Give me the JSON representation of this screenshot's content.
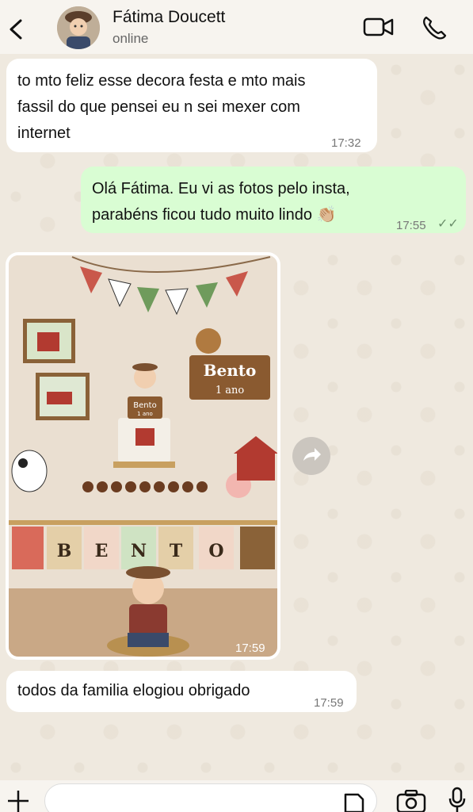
{
  "header": {
    "contact_name": "Fátima Doucett",
    "status": "online"
  },
  "messages": [
    {
      "dir": "in",
      "text_lines": [
        "to mto feliz esse decora festa e mto mais",
        "fassil do que pensei eu n sei mexer com",
        "internet"
      ],
      "time": "17:32"
    },
    {
      "dir": "out",
      "text_lines": [
        "Olá Fátima. Eu vi as fotos pelo insta,",
        "parabéns ficou tudo muito lindo 👏🏼"
      ],
      "time": "17:55",
      "ticks": "✓✓"
    },
    {
      "dir": "in",
      "type": "image",
      "time": "17:59",
      "photo": {
        "sign_name": "Bento",
        "sign_age": "1 ano",
        "topper_name": "Bento",
        "topper_age": "1 ano",
        "banner_letters": [
          "B",
          "E",
          "N",
          "T",
          "O"
        ]
      }
    },
    {
      "dir": "in",
      "text_lines": [
        "todos da familia elogiou obrigado"
      ],
      "time": "17:59"
    }
  ],
  "composer": {
    "value": ""
  },
  "icons": {
    "back": "chevron-left-icon",
    "video": "video-call-icon",
    "phone": "phone-icon",
    "forward": "forward-icon",
    "attach": "plus-icon",
    "sticker": "sticker-icon",
    "camera": "camera-icon",
    "mic": "microphone-icon"
  },
  "colors": {
    "outgoing_bubble": "#d9fdd3",
    "incoming_bubble": "#ffffff",
    "wallpaper": "#efe9df"
  }
}
